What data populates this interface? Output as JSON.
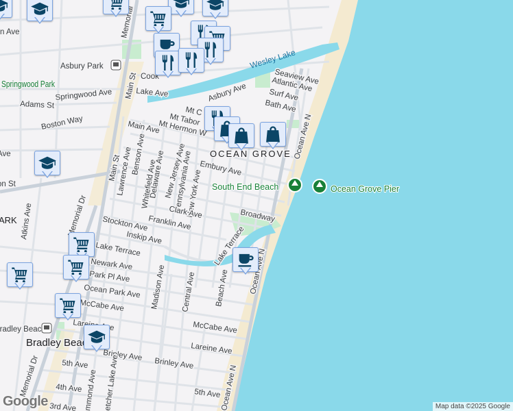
{
  "map": {
    "water_label": "Wesley Lake",
    "town_labels": {
      "ocean_grove": "OCEAN GROVE",
      "bradley_beach": "Bradley Beach",
      "park_partial": "ARK"
    },
    "transit_labels": {
      "asbury_park": "Asbury Park",
      "bradley_beach": "Bradley Beach"
    },
    "parks": {
      "springwood": "Springwood Park"
    },
    "pois": {
      "south_end_beach": "South End Beach",
      "ocean_grove_pier": "Ocean Grove Pier"
    },
    "streets": {
      "memorial_top": "Memorial",
      "main_st_top": "Main St",
      "cookman": "Cook",
      "lake_ave": "Lake Ave",
      "springwood_ave": "Springwood Ave",
      "adams_st": "Adams St",
      "boston_way": "Boston Way",
      "n_ave": "n Ave",
      "on_st": "on St",
      "asbury_ave": "Asbury Ave",
      "seaview_ave": "Seaview Ave",
      "atlantic_ave": "Atlantic Ave",
      "surf_ave": "Surf Ave",
      "bath_ave": "Bath Ave",
      "mt_carmel": "Mt C",
      "mt_tabor": "Mt Tabor",
      "mt_hermon": "Mt Hermon W",
      "main_ave": "Main Ave",
      "main_st": "Main St",
      "lawrence_ave": "Lawrence Ave",
      "benson_ave": "Benson Ave",
      "whitefield_ave": "Whitefield Ave",
      "delaware_ave": "Delaware Ave",
      "new_jersey_ave": "New Jersey Ave",
      "pennsylvania_ave": "Pennsylvania Ave",
      "new_york_ave": "New York Ave",
      "embury_ave": "Embury Ave",
      "ocean_ave_n_top": "Ocean Ave N",
      "broadway": "Broadway",
      "clark_ave": "Clark Ave",
      "franklin_ave": "Franklin Ave",
      "stockton_ave": "Stockton Ave",
      "inskip_ave": "Inskip Ave",
      "lake_terrace": "Lake Terrace",
      "lake_terrace_2": "Lake Terrace",
      "newark_ave": "Newark Ave",
      "park_pl_ave": "Park Pl Ave",
      "ocean_park_ave": "Ocean Park Ave",
      "mccabe_ave_w": "McCabe Ave",
      "mccabe_ave_e": "McCabe Ave",
      "lareine_w": "Lareine Ave",
      "lareine_e": "Lareine Ave",
      "madison_ave": "Madison Ave",
      "central_ave": "Central Ave",
      "beach_ave": "Beach Ave",
      "ocean_ave_n_mid": "Ocean Ave N",
      "ocean_ave_n_bot": "Ocean Ave N",
      "brinley_w": "Brinley Ave",
      "brinley_e": "Brinley Ave",
      "fifth_w": "5th Ave",
      "fifth_e": "5th Ave",
      "fourth": "4th Ave",
      "third": "3rd Ave",
      "hammond": "mmond Ave",
      "fletcher_lake": "etcher Lake Ave",
      "memorial_dr": "Memorial Dr",
      "memorial_dr_2": "Memorial Dr",
      "atkins_ave": "Atkins Ave",
      "ave_partial": "Ave"
    },
    "attribution": "Map data ©2025 Google",
    "logo": "Google",
    "colors": {
      "water": "#8ad9ea",
      "beach": "#f4ead0",
      "park": "#c8eccf",
      "marker_fill": "#e3ecfb",
      "marker_icon": "#0b4566"
    }
  },
  "markers": [
    {
      "type": "school"
    },
    {
      "type": "school"
    },
    {
      "type": "grocery"
    },
    {
      "type": "school"
    },
    {
      "type": "school"
    },
    {
      "type": "grocery"
    },
    {
      "type": "cafe"
    },
    {
      "type": "restaurant"
    },
    {
      "type": "restaurant"
    },
    {
      "type": "restaurant"
    },
    {
      "type": "grocery"
    },
    {
      "type": "shopping"
    },
    {
      "type": "shopping"
    },
    {
      "type": "school"
    },
    {
      "type": "grocery"
    },
    {
      "type": "grocery"
    },
    {
      "type": "grocery"
    },
    {
      "type": "grocery"
    },
    {
      "type": "school"
    },
    {
      "type": "cafe"
    }
  ]
}
